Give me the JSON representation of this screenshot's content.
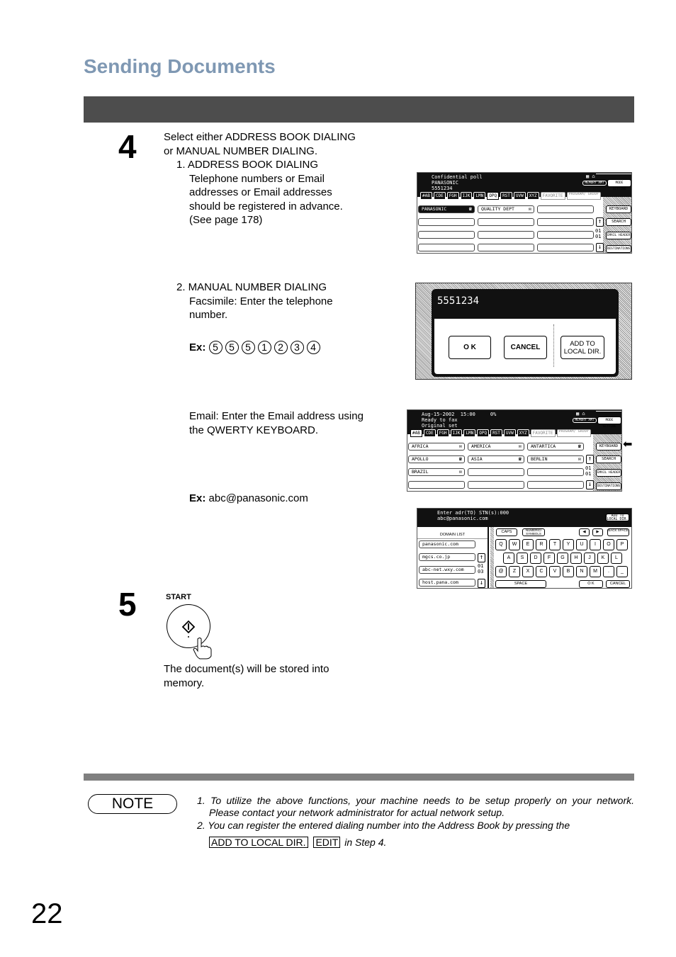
{
  "header": {
    "title": "Sending Documents"
  },
  "step4": {
    "number": "4",
    "intro_line1": "Select either ADDRESS BOOK DIALING",
    "intro_line2": "or MANUAL NUMBER DIALING.",
    "item1": {
      "title": "1. ADDRESS BOOK DIALING",
      "lines": [
        "Telephone numbers or Email",
        "addresses or Email addresses",
        "should be registered in advance.",
        "(See page 178)"
      ]
    },
    "item2": {
      "title": "2. MANUAL NUMBER DIALING",
      "lines": [
        "Facsimile: Enter the telephone",
        "number."
      ],
      "example_label": "Ex:",
      "example_keys": [
        "5",
        "5",
        "5",
        "1",
        "2",
        "3",
        "4"
      ]
    },
    "email": {
      "lines": [
        "Email: Enter the Email address using",
        "the QWERTY KEYBOARD."
      ],
      "example_label": "Ex:",
      "example_value": "abc@panasonic.com"
    }
  },
  "screen1": {
    "status_lines": [
      "Confidential poll",
      "PANASONIC",
      "5551234"
    ],
    "memory_label": "MEMORY AMT",
    "mode_setting": "MODE SETTING",
    "tabs": [
      "#AB",
      "CDE",
      "FGH",
      "IJK",
      "LMN",
      "OPQ",
      "RST",
      "UVW",
      "XYZ",
      "FAVORITE",
      "PROGRAM/ GROUP"
    ],
    "selected_tab": "OPQ",
    "entries": [
      "PANASONIC",
      "QUALITY DEPT"
    ],
    "side_buttons": [
      "KEYBOARD",
      "SEARCH",
      "EMAIL HEADER",
      "DESTINATIONS"
    ],
    "page_current": "01",
    "page_total": "01"
  },
  "screen2": {
    "number_display": "5551234",
    "buttons": {
      "ok": "O K",
      "cancel": "CANCEL",
      "add_to_local": "ADD TO LOCAL DIR."
    }
  },
  "screen3": {
    "status_lines": [
      "Aug-15-2002  15:00     0%",
      "Ready to fax",
      "Original set"
    ],
    "memory_label": "MEMORY AMT",
    "mode_setting": "MODE SETTING",
    "tabs": [
      "#AB",
      "CDE",
      "FGH",
      "IJK",
      "LMN",
      "OPQ",
      "RST",
      "UVW",
      "XYZ",
      "FAVORITE",
      "PROGRAM/ GROUP"
    ],
    "selected_tab": "#AB",
    "entries": [
      "AFRICA",
      "AMERICA",
      "ANTARTICA",
      "APOLLO",
      "ASIA",
      "BERLIN",
      "BRAZIL"
    ],
    "side_buttons": [
      "KEYBOARD",
      "SEARCH",
      "EMAIL HEADER",
      "DESTINATIONS"
    ],
    "page_current": "01",
    "page_total": "01"
  },
  "screen4": {
    "status_line1": "Enter adr(TO) STN(s):000",
    "status_line2": "abc@panasonic.com",
    "add_to_local": "ADD TO LOCAL DIR.",
    "domain_list_title": "DOMAIN LIST",
    "domains": [
      "panasonic.com",
      "mgcs.co.jp",
      "abc-net.wxy.com",
      "host.pana.com"
    ],
    "page_current": "01",
    "page_total": "03",
    "caps": "CAPS",
    "numeric_symbols": "NUMERIC/ SYMBOLS",
    "back_space": "BACK SPACE",
    "row1": [
      "Q",
      "W",
      "E",
      "R",
      "T",
      "Y",
      "U",
      "I",
      "O",
      "P"
    ],
    "row2": [
      "A",
      "S",
      "D",
      "F",
      "G",
      "H",
      "J",
      "K",
      "L"
    ],
    "row3": [
      "@",
      "Z",
      "X",
      "C",
      "V",
      "B",
      "N",
      "M",
      ".",
      "_"
    ],
    "space": "SPACE",
    "ok": "O K",
    "cancel": "CANCEL"
  },
  "step5": {
    "number": "5",
    "start_label": "START",
    "lines": [
      "The document(s) will be stored into",
      "memory."
    ]
  },
  "note": {
    "badge": "NOTE",
    "item1_line1": "1. To utilize the above functions, your machine needs to be setup properly on your network.",
    "item1_line2": "Please contact your network administrator for actual network setup.",
    "item2_line1": "2. You can register the entered dialing number into the Address Book by pressing the",
    "key1": "ADD TO LOCAL DIR.",
    "key2": "EDIT",
    "item2_suffix": "in Step 4."
  },
  "page_number": "22"
}
